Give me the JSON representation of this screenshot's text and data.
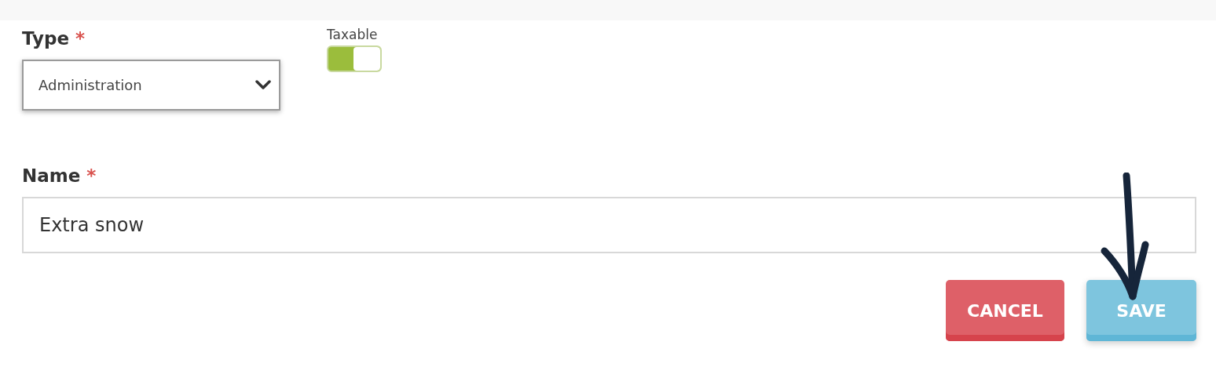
{
  "type_field": {
    "label": "Type",
    "required_mark": "*",
    "value": "Administration"
  },
  "taxable": {
    "label": "Taxable",
    "on": true
  },
  "name_field": {
    "label": "Name",
    "required_mark": "*",
    "value": "Extra snow"
  },
  "buttons": [
    {
      "label": "CANCEL",
      "kind": "cancel"
    },
    {
      "label": "SAVE",
      "kind": "save"
    }
  ]
}
